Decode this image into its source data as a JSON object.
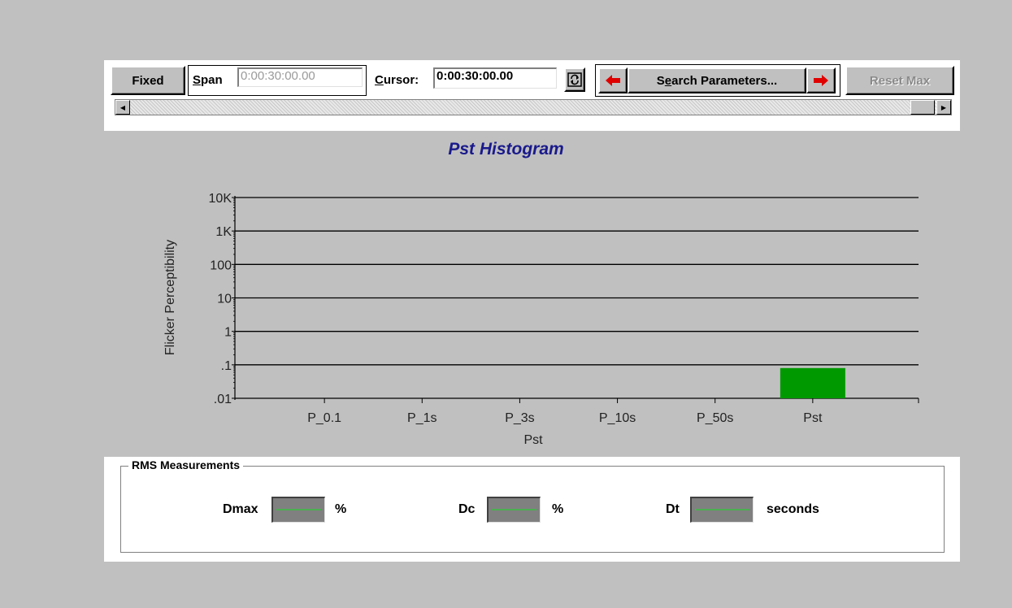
{
  "toolbar": {
    "fixed_label": "Fixed",
    "span_label_u": "S",
    "span_label_rest": "pan",
    "span_value": "0:00:30:00.00",
    "cursor_label_u": "C",
    "cursor_label_rest": "ursor:",
    "cursor_value": "0:00:30:00.00",
    "search_label_pre": "S",
    "search_label_u": "e",
    "search_label_post": "arch Parameters...",
    "reset_max_label": "Reset Max",
    "refresh_icon": "refresh-icon",
    "prev_icon": "arrow-left-icon",
    "next_icon": "arrow-right-icon"
  },
  "chart_data": {
    "type": "bar",
    "title": "Pst Histogram",
    "xlabel": "Pst",
    "ylabel": "Flicker Perceptibility",
    "yscale": "log",
    "ylim": [
      0.01,
      10000
    ],
    "yticks": [
      ".01",
      ".1",
      "1",
      "10",
      "100",
      "1K",
      "10K"
    ],
    "categories": [
      "P_0.1",
      "P_1s",
      "P_3s",
      "P_10s",
      "P_50s",
      "Pst"
    ],
    "values": [
      null,
      null,
      null,
      null,
      null,
      0.08
    ],
    "bar_color": "#009900",
    "grid": true
  },
  "rms": {
    "title": "RMS Measurements",
    "dmax_label": "Dmax",
    "dmax_unit": "%",
    "dc_label": "Dc",
    "dc_unit": "%",
    "dt_label": "Dt",
    "dt_unit": "seconds"
  }
}
